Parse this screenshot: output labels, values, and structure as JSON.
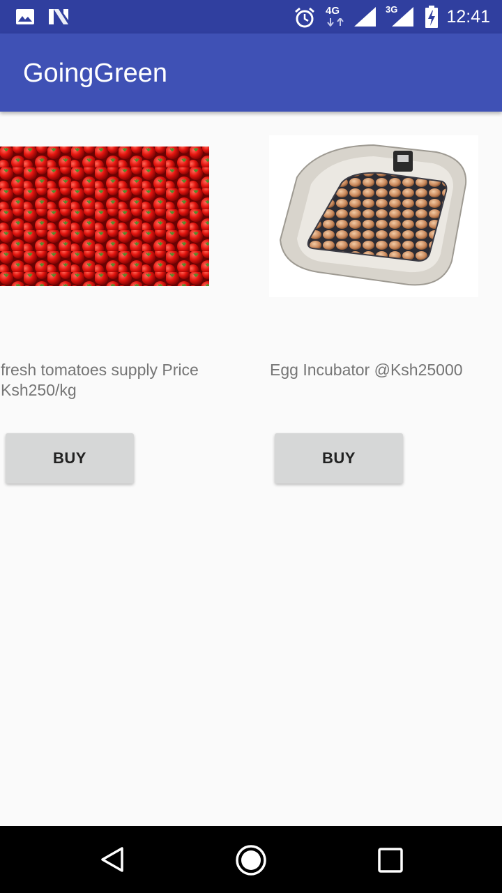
{
  "status_bar": {
    "time": "12:41",
    "network_primary": "4G",
    "network_secondary": "3G",
    "icons": [
      "image-icon",
      "n-notification-icon",
      "alarm-icon",
      "signal-icon",
      "battery-charging-icon"
    ]
  },
  "app_bar": {
    "title": "GoingGreen",
    "color": "#3f51b5",
    "status_color": "#303f9f"
  },
  "products": [
    {
      "image": "tomatoes-image",
      "description": "fresh tomatoes supply Price Ksh250/kg",
      "button_label": "BUY"
    },
    {
      "image": "egg-incubator-image",
      "description": "Egg Incubator @Ksh25000",
      "button_label": "BUY"
    }
  ],
  "nav_bar": {
    "icons": [
      "back-icon",
      "home-icon",
      "recents-icon"
    ]
  }
}
